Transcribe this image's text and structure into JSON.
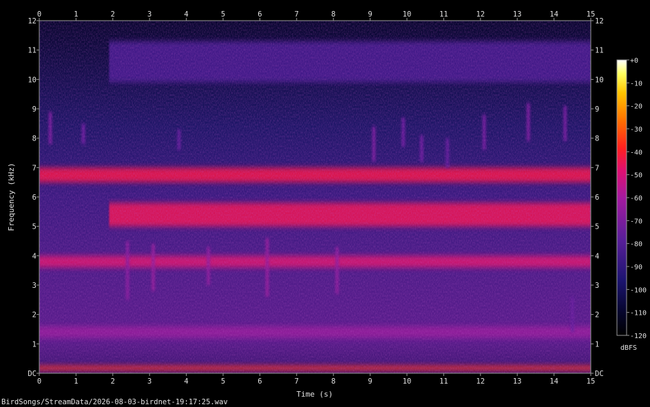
{
  "file_path": "BirdSongs/StreamData/2026-08-03-birdnet-19:17:25.wav",
  "chart_data": {
    "type": "heatmap",
    "xlabel": "Time (s)",
    "ylabel": "Frequency (kHz)",
    "x_range": [
      0,
      15
    ],
    "y_range": [
      0,
      12
    ],
    "x_ticks": [
      "0",
      "1",
      "2",
      "3",
      "4",
      "5",
      "6",
      "7",
      "8",
      "9",
      "10",
      "11",
      "12",
      "13",
      "14",
      "15"
    ],
    "y_ticks": [
      "DC",
      "1",
      "2",
      "3",
      "4",
      "5",
      "6",
      "7",
      "8",
      "9",
      "10",
      "11",
      "12"
    ],
    "colorbar": {
      "label": "dBFS",
      "range": [
        -120,
        0
      ],
      "ticks": [
        "+0",
        "-10",
        "-20",
        "-30",
        "-40",
        "-50",
        "-60",
        "-70",
        "-80",
        "-90",
        "-100",
        "-110",
        "-120"
      ]
    },
    "bands": [
      {
        "f_low": 0.1,
        "f_high": 0.25,
        "t_start": 0,
        "t_end": 15,
        "db": -48
      },
      {
        "f_low": 1.2,
        "f_high": 1.6,
        "t_start": 0,
        "t_end": 15,
        "db": -74
      },
      {
        "f_low": 3.6,
        "f_high": 4.0,
        "t_start": 0,
        "t_end": 15,
        "db": -62
      },
      {
        "f_low": 5.0,
        "f_high": 5.8,
        "t_start": 1.9,
        "t_end": 15,
        "db": -58
      },
      {
        "f_low": 6.5,
        "f_high": 7.0,
        "t_start": 0,
        "t_end": 15,
        "db": -56
      },
      {
        "f_low": 9.9,
        "f_high": 11.3,
        "t_start": 1.9,
        "t_end": 15,
        "db": -88
      }
    ],
    "calls": [
      {
        "t": 0.3,
        "f_low": 7.8,
        "f_high": 8.9,
        "db": -78
      },
      {
        "t": 1.2,
        "f_low": 7.8,
        "f_high": 8.5,
        "db": -80
      },
      {
        "t": 2.4,
        "f_low": 2.5,
        "f_high": 4.5,
        "db": -76
      },
      {
        "t": 3.1,
        "f_low": 2.8,
        "f_high": 4.4,
        "db": -74
      },
      {
        "t": 3.8,
        "f_low": 7.6,
        "f_high": 8.3,
        "db": -82
      },
      {
        "t": 4.6,
        "f_low": 3.0,
        "f_high": 4.3,
        "db": -75
      },
      {
        "t": 6.2,
        "f_low": 2.6,
        "f_high": 4.6,
        "db": -74
      },
      {
        "t": 8.1,
        "f_low": 2.7,
        "f_high": 4.3,
        "db": -75
      },
      {
        "t": 9.1,
        "f_low": 7.2,
        "f_high": 8.4,
        "db": -78
      },
      {
        "t": 9.9,
        "f_low": 7.7,
        "f_high": 8.7,
        "db": -80
      },
      {
        "t": 10.4,
        "f_low": 7.2,
        "f_high": 8.1,
        "db": -80
      },
      {
        "t": 11.1,
        "f_low": 7.0,
        "f_high": 8.0,
        "db": -82
      },
      {
        "t": 12.1,
        "f_low": 7.6,
        "f_high": 8.8,
        "db": -79
      },
      {
        "t": 13.3,
        "f_low": 7.9,
        "f_high": 9.2,
        "db": -78
      },
      {
        "t": 14.3,
        "f_low": 7.9,
        "f_high": 9.1,
        "db": -79
      },
      {
        "t": 14.5,
        "f_low": 1.4,
        "f_high": 2.6,
        "db": -82
      }
    ]
  }
}
